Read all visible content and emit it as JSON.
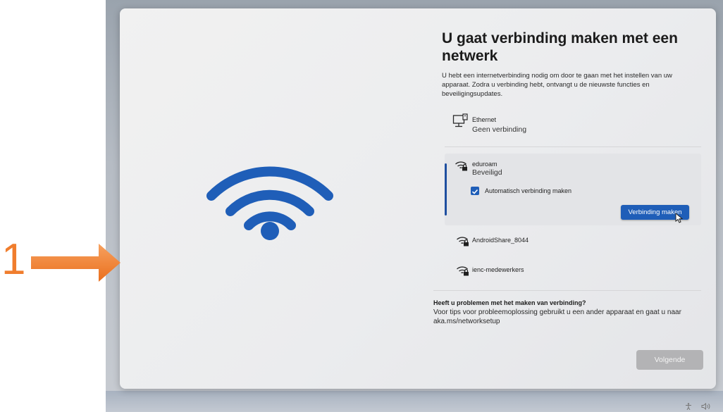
{
  "step_marker": "1",
  "heading": "U gaat verbinding maken met een netwerk",
  "description": "U hebt een internetverbinding nodig om door te gaan met het instellen van uw apparaat. Zodra u verbinding hebt, ontvangt u de nieuwste functies en beveiligingsupdates.",
  "networks": [
    {
      "name": "Ethernet",
      "status": "Geen verbinding",
      "icon": "ethernet-icon"
    },
    {
      "name": "eduroam",
      "status": "Beveiligd",
      "icon": "wifi-secured-icon",
      "selected": true
    },
    {
      "name": "AndroidShare_8044",
      "icon": "wifi-secured-icon"
    },
    {
      "name": "ienc-medewerkers",
      "icon": "wifi-secured-icon"
    }
  ],
  "auto_connect": {
    "label": "Automatisch verbinding maken",
    "checked": true
  },
  "connect_button": "Verbinding maken",
  "help": {
    "title": "Heeft u problemen met het maken van verbinding?",
    "text": "Voor tips voor probleemoplossing gebruikt u een ander apparaat en gaat u naar aka.ms/networksetup"
  },
  "next_button": "Volgende",
  "colors": {
    "accent": "#1f5eb8",
    "wifi_illustration": "#1f5eb8",
    "annotation": "#f07d2d"
  }
}
